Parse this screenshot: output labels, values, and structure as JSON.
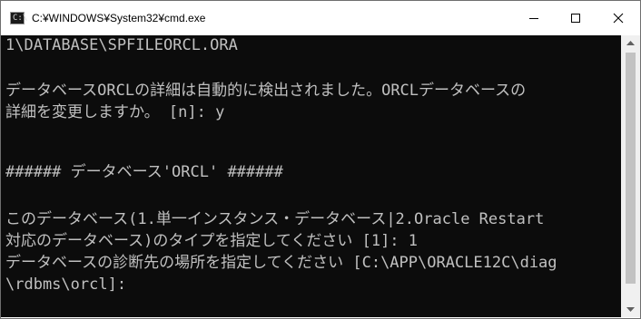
{
  "window": {
    "title": "C:¥WINDOWS¥System32¥cmd.exe",
    "icon": "console-icon",
    "icon_glyph": "C:\\"
  },
  "controls": {
    "minimize": "minimize-icon",
    "maximize": "maximize-icon",
    "close": "close-icon"
  },
  "console": {
    "background": "#0c0c0c",
    "foreground": "#c0c0c0",
    "lines": [
      "1\\DATABASE\\SPFILEORCL.ORA",
      "データベースORCLの詳細は自動的に検出されました。ORCLデータベースの",
      "詳細を変更しますか。 [n]: y",
      "###### データベース'ORCL' ######",
      "このデータベース(1.単一インスタンス・データベース|2.Oracle Restart",
      "対応のデータベース)のタイプを指定してください [1]: 1",
      "データベースの診断先の場所を指定してください [C:\\APP\\ORACLE12C\\diag",
      "\\rdbms\\orcl]:"
    ]
  },
  "scrollbar": {
    "up_icon": "scroll-up-arrow-icon",
    "down_icon": "scroll-down-arrow-icon"
  }
}
